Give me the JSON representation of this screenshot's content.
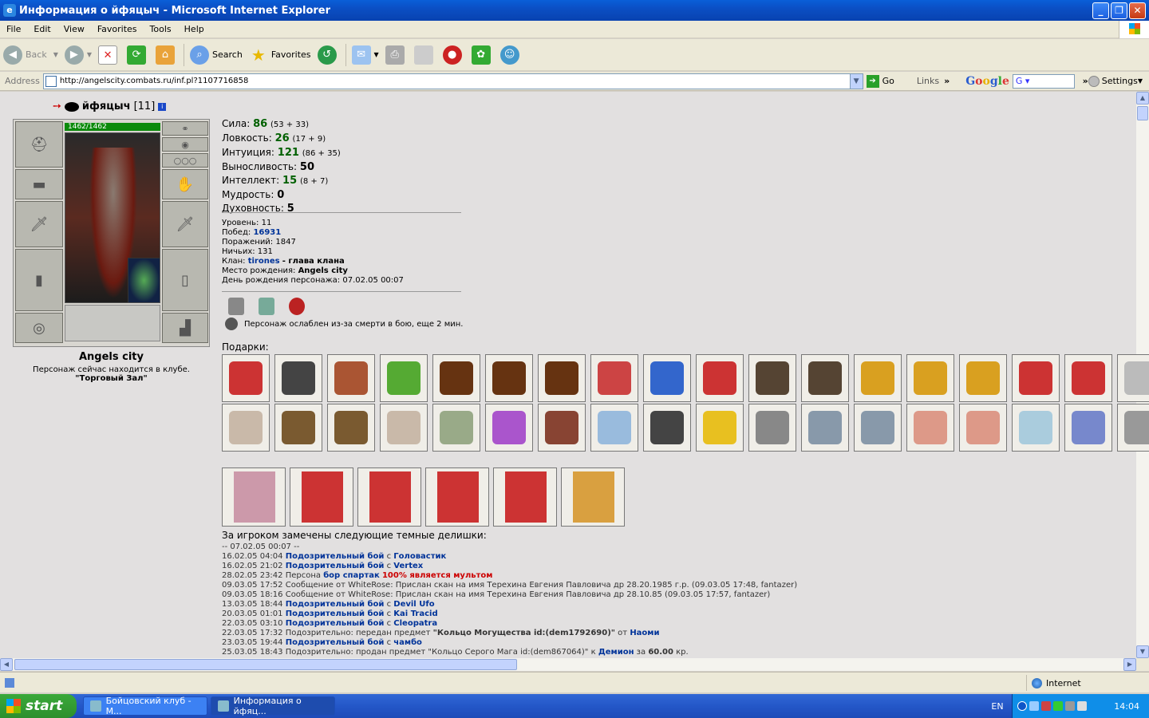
{
  "window": {
    "title": "Информация о йфяцыч - Microsoft Internet Explorer"
  },
  "menu": [
    "File",
    "Edit",
    "View",
    "Favorites",
    "Tools",
    "Help"
  ],
  "toolbar": {
    "back": "Back",
    "search": "Search",
    "favorites": "Favorites"
  },
  "address": {
    "label": "Address",
    "url": "http://angelscity.combats.ru/inf.pl?1107716858",
    "go": "Go",
    "links": "Links",
    "google": "Google",
    "google_value": "G",
    "settings": "Settings"
  },
  "character": {
    "name": "йфяцыч",
    "level_label": "[11]",
    "hp": "1462/1462",
    "location_city": "Angels city",
    "location_text": "Персонаж сейчас находится в клубе.",
    "location_room": "\"Торговый Зал\""
  },
  "stats": [
    {
      "label": "Сила:",
      "value": "86",
      "detail": "(53 + 33)"
    },
    {
      "label": "Ловкость:",
      "value": "26",
      "detail": "(17 + 9)"
    },
    {
      "label": "Интуиция:",
      "value": "121",
      "detail": "(86 + 35)"
    },
    {
      "label": "Выносливость:",
      "value": "50",
      "detail": ""
    },
    {
      "label": "Интеллект:",
      "value": "15",
      "detail": "(8 + 7)"
    },
    {
      "label": "Мудрость:",
      "value": "0",
      "detail": ""
    },
    {
      "label": "Духовность:",
      "value": "5",
      "detail": ""
    }
  ],
  "info": {
    "level": "Уровень: 11",
    "wins_label": "Побед:",
    "wins": "16931",
    "losses": "Поражений: 1847",
    "draws": "Ничьих: 131",
    "clan_label": "Клан:",
    "clan": "tirones",
    "clan_role": "- глава клана",
    "birthplace_label": "Место рождения:",
    "birthplace": "Angels city",
    "birthday": "День рождения персонажа: 07.02.05 00:07"
  },
  "weakened": "Персонаж ослаблен из-за смерти в бою, еще 2 мин.",
  "gifts_label": "Подарки:",
  "deals_label": "За игроком замечены следующие темные делишки:",
  "log": [
    {
      "t": "-- 07.02.05 00:07 --"
    },
    {
      "t": "16.02.05 04:04",
      "link": "Подозрительный бой",
      "mid": "с",
      "who": "Головастик"
    },
    {
      "t": "16.02.05 21:02",
      "link": "Подозрительный бой",
      "mid": "с",
      "who": "Vertex"
    },
    {
      "t": "28.02.05 23:42 Персона",
      "link": "бор спартак",
      "red": "100% является мультом"
    },
    {
      "t": "09.03.05 17:52 Сообщение от WhiteRose: Прислан скан на имя Терехина Евгения Павловича др 28.20.1985 г.р. (09.03.05 17:48, fantazer)"
    },
    {
      "t": "09.03.05 18:16 Сообщение от WhiteRose: Прислан скан на имя Терехина Евгения Павловича др 28.10.85 (09.03.05 17:57, fantazer)"
    },
    {
      "t": "13.03.05 18:44",
      "link": "Подозрительный бой",
      "mid": "с",
      "who": "Devil Ufo"
    },
    {
      "t": "20.03.05 01:01",
      "link": "Подозрительный бой",
      "mid": "с",
      "who": "Kai Tracid"
    },
    {
      "t": "22.03.05 03:10",
      "link": "Подозрительный бой",
      "mid": "с",
      "who": "Cleopatra"
    },
    {
      "t": "22.03.05 17:32 Подозрительно: передан предмет",
      "n": "\"Кольцо Могущества id:(dem1792690)\"",
      "mid": "от",
      "who": "Наоми"
    },
    {
      "t": "23.03.05 19:44",
      "link": "Подозрительный бой",
      "mid": "с",
      "who": "чамбо"
    },
    {
      "t": "25.03.05 18:43 Подозрительно: продан предмет \"Кольцо Серого Мага id:(dem867064)\" к",
      "who": "Демион",
      "tail": "за",
      "price": "60.00",
      "tail2": "кр."
    }
  ],
  "status": {
    "zone": "Internet"
  },
  "taskbar": {
    "start": "start",
    "task1": "Бойцовский клуб - M...",
    "task2": "Информация о йфяц...",
    "lang": "EN",
    "clock": "14:04"
  }
}
